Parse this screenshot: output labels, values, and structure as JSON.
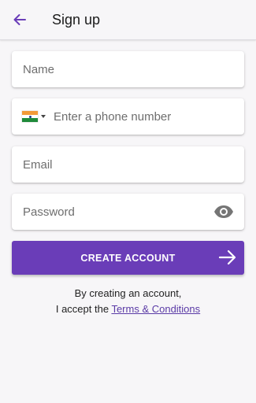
{
  "header": {
    "title": "Sign up",
    "back_icon": "arrow-left-icon"
  },
  "form": {
    "name_placeholder": "Name",
    "phone": {
      "country": "India",
      "flag_icon": "india-flag-icon",
      "placeholder": "Enter a phone number"
    },
    "email_placeholder": "Email",
    "password_placeholder": "Password",
    "password_toggle_icon": "eye-icon"
  },
  "actions": {
    "create_label": "CREATE ACCOUNT",
    "create_icon": "arrow-right-icon"
  },
  "terms": {
    "line1": "By creating an account,",
    "line2_prefix": "I accept the ",
    "link_label": "Terms & Conditions"
  },
  "colors": {
    "primary": "#6a3db8",
    "background": "#f7f6f8",
    "link": "#5a3aa6"
  }
}
